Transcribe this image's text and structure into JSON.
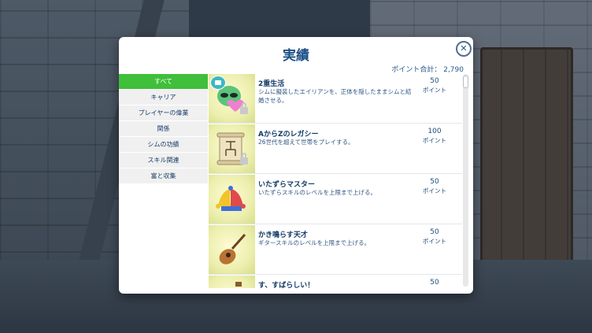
{
  "dialog": {
    "title": "実績",
    "total_points": "ポイント合計： 2,790",
    "close_label": "✕"
  },
  "sidebar": {
    "categories": [
      {
        "label": "すべて",
        "active": true
      },
      {
        "label": "キャリア",
        "active": false
      },
      {
        "label": "プレイヤーの偉業",
        "active": false
      },
      {
        "label": "関係",
        "active": false
      },
      {
        "label": "シムの功績",
        "active": false
      },
      {
        "label": "スキル関連",
        "active": false
      },
      {
        "label": "富と収集",
        "active": false
      }
    ]
  },
  "achievements": [
    {
      "title": "2重生活",
      "desc": "シムに擬装したエイリアンを、正体を隠したままシムと結婚させる。",
      "points": "50",
      "unit": "ポイント",
      "icon": "alien-heart-icon",
      "locked": true
    },
    {
      "title": "AからZのレガシー",
      "desc": "26世代を超えて世帯をプレイする。",
      "points": "100",
      "unit": "ポイント",
      "icon": "scroll-family-tree-icon",
      "locked": true
    },
    {
      "title": "いたずらマスター",
      "desc": "いたずらスキルのレベルを上限まで上げる。",
      "points": "50",
      "unit": "ポイント",
      "icon": "jester-hat-icon",
      "locked": false
    },
    {
      "title": "かき鳴らす天才",
      "desc": "ギタースキルのレベルを上限まで上げる。",
      "points": "50",
      "unit": "ポイント",
      "icon": "guitar-icon",
      "locked": false
    },
    {
      "title": "す、すばらしい！",
      "desc": "",
      "points": "50",
      "unit": "",
      "icon": "trophy-icon",
      "locked": false
    }
  ],
  "colors": {
    "accent_green": "#3fbf3a",
    "title_blue": "#1d4f86",
    "thumb_yellow": "#ecefae"
  }
}
